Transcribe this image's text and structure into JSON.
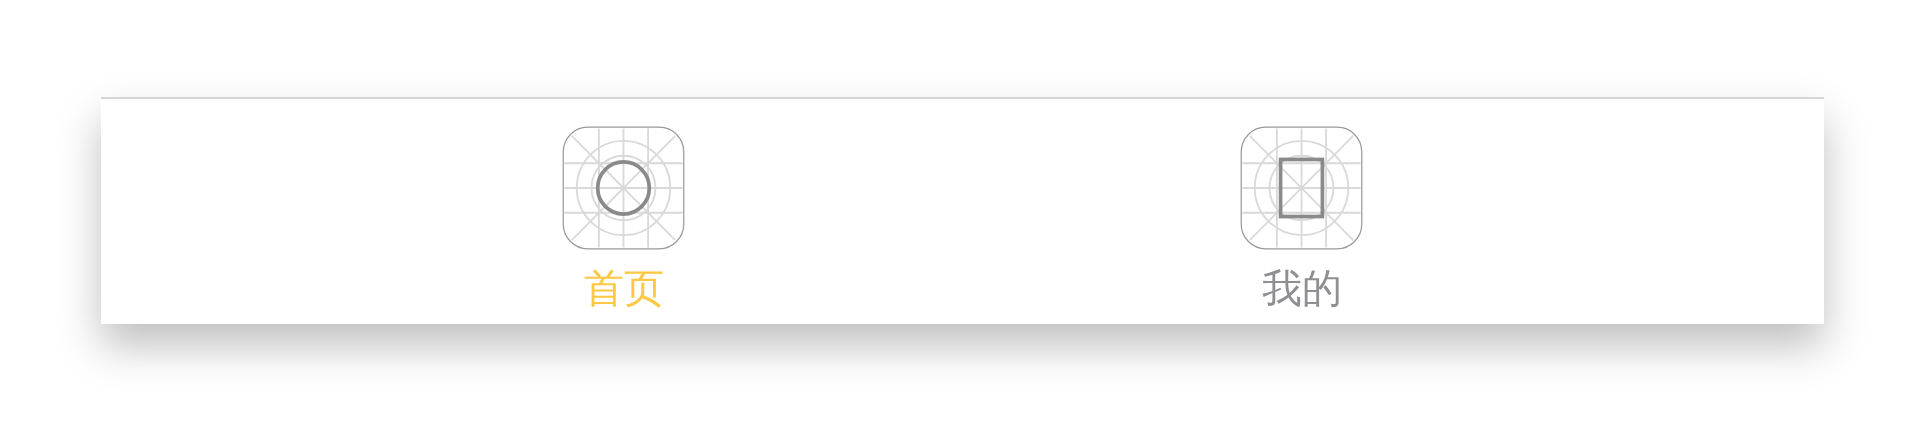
{
  "tab_bar": {
    "tabs": [
      {
        "label": "首页",
        "kind": "circle",
        "selected": true
      },
      {
        "label": "我的",
        "kind": "square",
        "selected": false
      }
    ]
  }
}
